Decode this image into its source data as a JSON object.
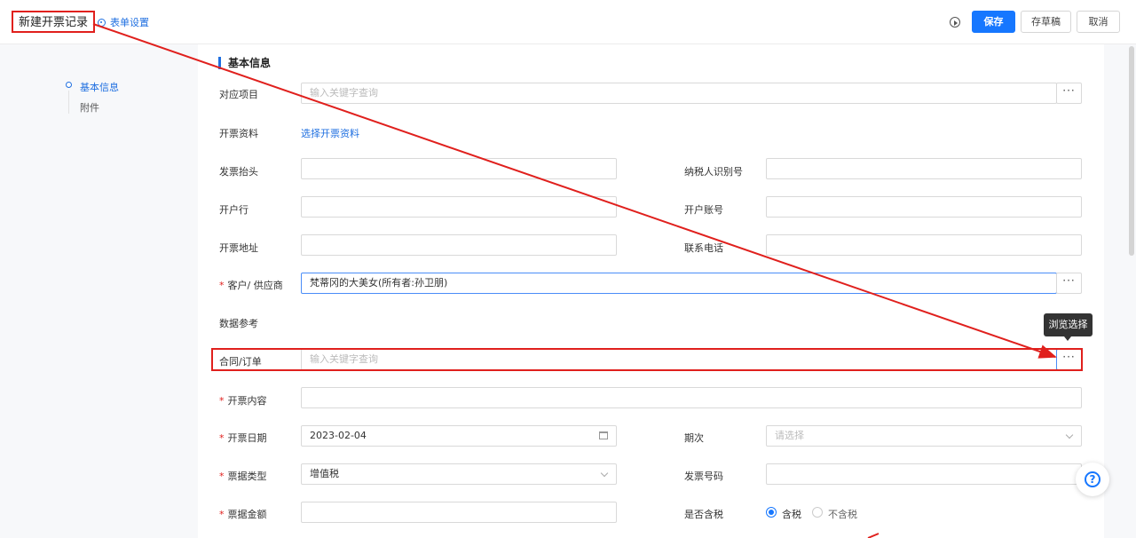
{
  "header": {
    "title": "新建开票记录",
    "form_setting": "表单设置",
    "save": "保存",
    "draft": "存草稿",
    "cancel": "取消"
  },
  "nav": {
    "items": [
      {
        "label": "基本信息"
      },
      {
        "label": "附件"
      }
    ]
  },
  "section": {
    "title": "基本信息"
  },
  "fields": {
    "project": {
      "label": "对应项目",
      "placeholder": "输入关键字查询"
    },
    "invoice_info": {
      "label": "开票资料",
      "link": "选择开票资料"
    },
    "invoice_title": {
      "label": "发票抬头",
      "value": ""
    },
    "taxpayer_id": {
      "label": "纳税人识别号",
      "value": ""
    },
    "bank": {
      "label": "开户行",
      "value": ""
    },
    "account": {
      "label": "开户账号",
      "value": ""
    },
    "address": {
      "label": "开票地址",
      "value": ""
    },
    "phone": {
      "label": "联系电话",
      "value": ""
    },
    "customer": {
      "label": "客户/ 供应商",
      "value": "梵蒂冈的大美女(所有者:孙卫朋)"
    },
    "data_ref": {
      "label": "数据参考"
    },
    "contract": {
      "label": "合同/订单",
      "placeholder": "输入关键字查询"
    },
    "content": {
      "label": "开票内容",
      "value": ""
    },
    "date": {
      "label": "开票日期",
      "value": "2023-02-04"
    },
    "period": {
      "label": "期次",
      "placeholder": "请选择"
    },
    "type": {
      "label": "票据类型",
      "value": "增值税"
    },
    "invoice_no": {
      "label": "发票号码",
      "value": ""
    },
    "amount": {
      "label": "票据金额",
      "value": ""
    },
    "tax_included": {
      "label": "是否含税",
      "options": [
        "含税",
        "不含税"
      ],
      "selected": "含税"
    }
  },
  "tooltip": "浏览选择",
  "more_glyph": "···",
  "help_glyph": "?",
  "colors": {
    "accent": "#1677ff",
    "annotation": "#e0201d"
  }
}
